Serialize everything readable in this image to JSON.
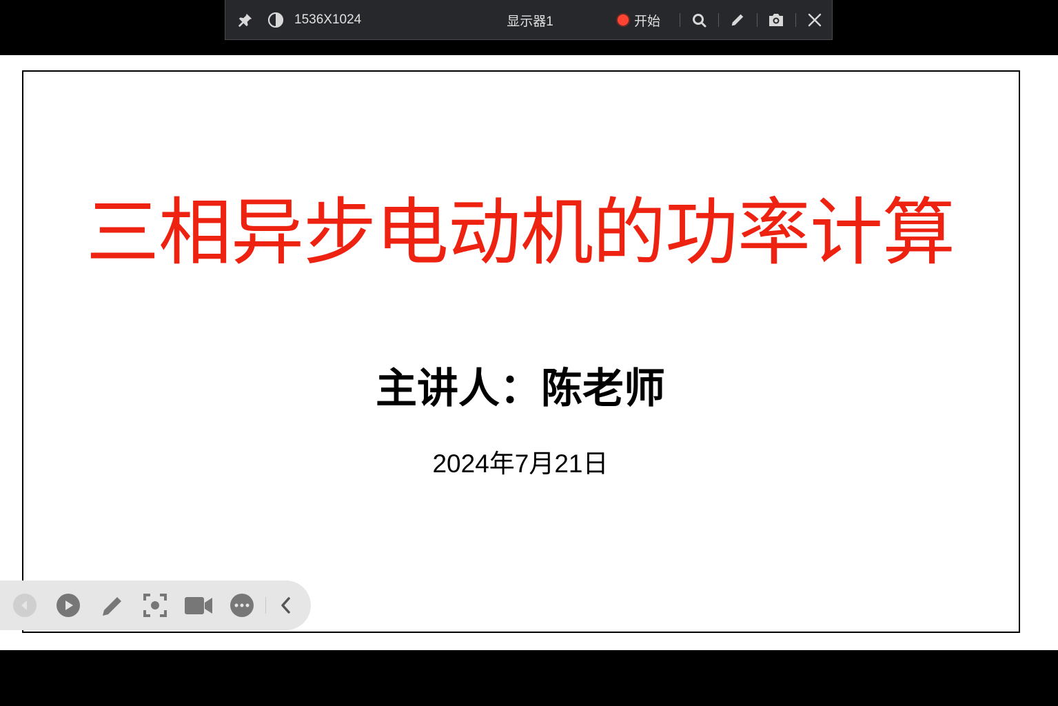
{
  "toolbar": {
    "resolution": "1536X1024",
    "monitor": "显示器1",
    "start_label": "开始",
    "icons": [
      "pin-icon",
      "contrast-icon",
      "record-dot-icon",
      "search-icon",
      "pen-icon",
      "camera-icon",
      "close-icon"
    ]
  },
  "slide": {
    "title": "三相异步电动机的功率计算",
    "presenter": "主讲人：陈老师",
    "date": "2024年7月21日",
    "title_color": "#ee2211"
  },
  "presentation_toolbar": {
    "icons": [
      "previous-icon",
      "play-icon",
      "pen-icon",
      "focus-capture-icon",
      "video-camera-icon",
      "more-icon",
      "collapse-chevron-icon"
    ]
  }
}
